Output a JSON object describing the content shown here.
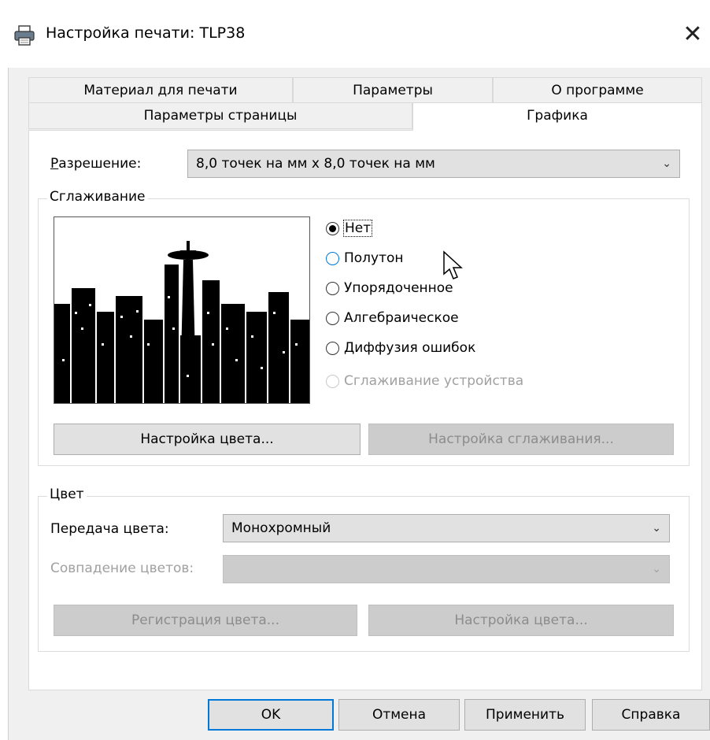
{
  "window": {
    "title": "Настройка печати: TLP38",
    "close": "✕"
  },
  "tabs": {
    "material": "Материал для печати",
    "params": "Параметры",
    "about": "О программе",
    "page": "Параметры страницы",
    "graphics": "Графика"
  },
  "resolution": {
    "label": "Разрешение:",
    "value": "8,0 точек на мм x 8,0 точек на мм"
  },
  "smoothing": {
    "title": "Сглаживание",
    "options": [
      "Нет",
      "Полутон",
      "Упорядоченное",
      "Алгебраическое",
      "Диффузия ошибок",
      "Сглаживание устройства"
    ],
    "selected": "Нет",
    "color_setup_button": "Настройка цвета...",
    "smooth_setup_button": "Настройка сглаживания..."
  },
  "color": {
    "title": "Цвет",
    "transfer_label": "Передача цвета:",
    "transfer_value": "Монохромный",
    "match_label": "Совпадение цветов:",
    "match_value": "",
    "register_button": "Регистрация цвета...",
    "color_setup_button": "Настройка цвета..."
  },
  "footer": {
    "ok": "OK",
    "cancel": "Отмена",
    "apply": "Применить",
    "help": "Справка"
  },
  "icons": {
    "printer": "printer-icon",
    "chevron": "chevron-down-icon",
    "cursor": "mouse-cursor-icon"
  }
}
